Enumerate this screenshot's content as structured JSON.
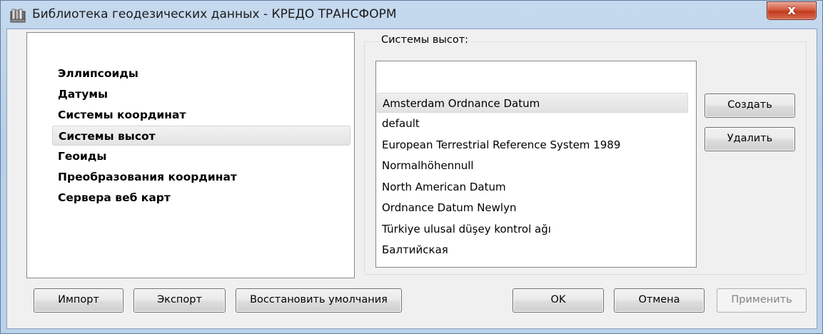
{
  "window": {
    "title": "Библиотека геодезических данных - КРЕДО ТРАНСФОРМ",
    "close_label": "x",
    "app_icon": "library-icon"
  },
  "nav": {
    "items": [
      {
        "label": "Эллипсоиды"
      },
      {
        "label": "Датумы"
      },
      {
        "label": "Системы координат"
      },
      {
        "label": "Системы высот",
        "selected": true
      },
      {
        "label": "Геоиды"
      },
      {
        "label": "Преобразования координат"
      },
      {
        "label": "Сервера веб карт"
      }
    ]
  },
  "heights": {
    "group_label": "Системы высот:",
    "items": [
      {
        "label": "Amsterdam Ordnance Datum",
        "selected": true
      },
      {
        "label": "default"
      },
      {
        "label": "European Terrestrial Reference System 1989"
      },
      {
        "label": "Normalhöhennull"
      },
      {
        "label": "North American Datum"
      },
      {
        "label": "Ordnance Datum Newlyn"
      },
      {
        "label": "Türkiye ulusal düşey kontrol ağı"
      },
      {
        "label": "Балтийская"
      }
    ],
    "create_label": "Создать",
    "delete_label": "Удалить"
  },
  "footer": {
    "import_label": "Импорт",
    "export_label": "Экспорт",
    "restore_label": "Восстановить умолчания",
    "ok_label": "OK",
    "cancel_label": "Отмена",
    "apply_label": "Применить"
  }
}
